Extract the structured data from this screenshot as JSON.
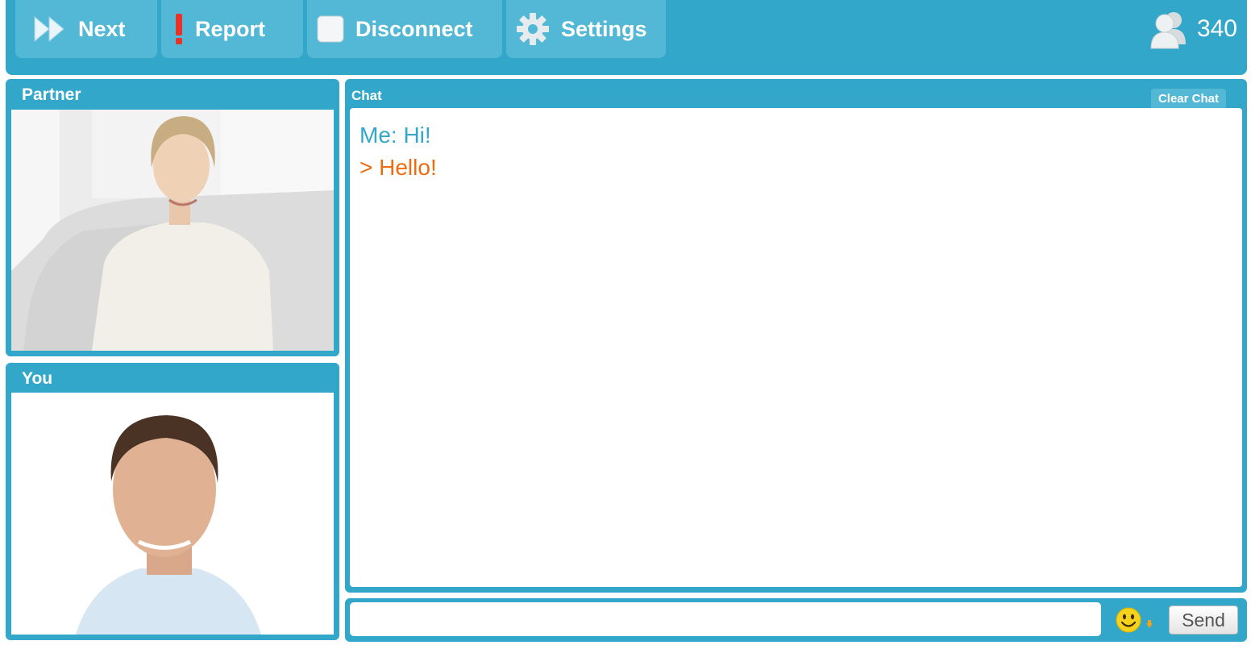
{
  "toolbar": {
    "next_label": "Next",
    "report_label": "Report",
    "disconnect_label": "Disconnect",
    "settings_label": "Settings",
    "online_count": "340"
  },
  "partner_panel": {
    "title": "Partner"
  },
  "you_panel": {
    "title": "You"
  },
  "chat": {
    "title": "Chat",
    "clear_label": "Clear Chat",
    "messages": [
      {
        "sender": "me",
        "text": "Me: Hi!"
      },
      {
        "sender": "partner",
        "text": "> Hello!"
      }
    ]
  },
  "composer": {
    "input_value": "",
    "send_label": "Send"
  },
  "colors": {
    "primary": "#33a7c9",
    "button": "#53b7d6",
    "me_message": "#33a7c9",
    "partner_message": "#f06b0e",
    "report_icon": "#e8332a"
  }
}
